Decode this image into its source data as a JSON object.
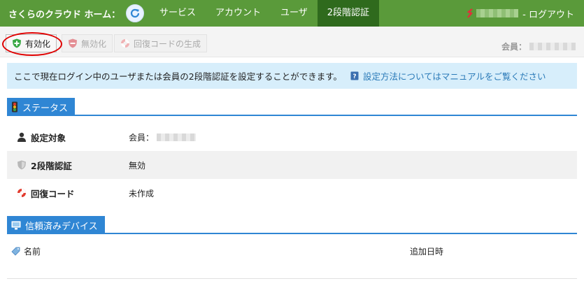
{
  "topnav": {
    "brand": "さくらのクラウド ホーム：",
    "items": [
      {
        "label": "サービス"
      },
      {
        "label": "アカウント"
      },
      {
        "label": "ユーザ"
      },
      {
        "label": "2段階認証",
        "active": true
      }
    ],
    "logout": "- ログアウト",
    "colors": {
      "bar": "#5a9a3a",
      "active": "#2f6a1d"
    }
  },
  "toolbar": {
    "enable_label": "有効化",
    "disable_label": "無効化",
    "recovery_label": "回復コードの生成",
    "member_label": "会員："
  },
  "info": {
    "text": "ここで現在ログイン中のユーザまたは会員の2段階認証を設定することができます。",
    "link": "設定方法についてはマニュアルをご覧ください"
  },
  "status": {
    "title": "ステータス",
    "rows": [
      {
        "label": "設定対象",
        "value": "会員：",
        "icon": "user-icon"
      },
      {
        "label": "2段階認証",
        "value": "無効",
        "icon": "shield-icon"
      },
      {
        "label": "回復コード",
        "value": "未作成",
        "icon": "lifebuoy-icon"
      }
    ]
  },
  "devices": {
    "title": "信頼済みデバイス",
    "columns": {
      "name": "名前",
      "added": "追加日時"
    }
  }
}
